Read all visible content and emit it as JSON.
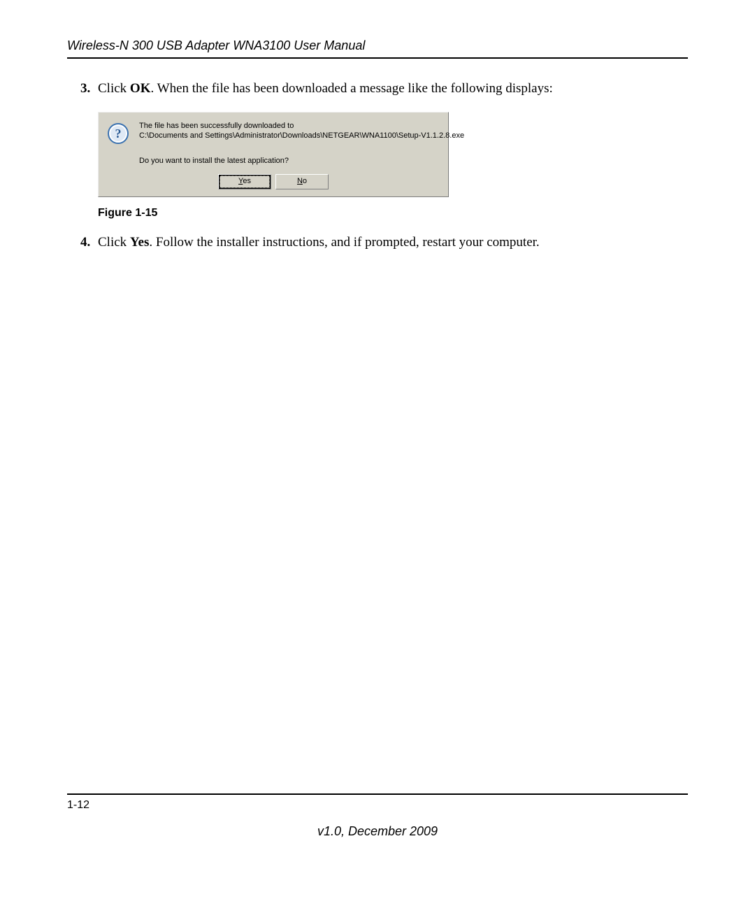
{
  "header": {
    "title": "Wireless-N 300 USB Adapter WNA3100 User Manual"
  },
  "steps": {
    "item3": {
      "number": "3.",
      "prefix": "Click ",
      "bold": "OK",
      "suffix": ". When the file has been downloaded a message like the following displays:"
    },
    "item4": {
      "number": "4.",
      "prefix": "Click ",
      "bold": "Yes",
      "suffix": ". Follow the installer instructions, and if prompted, restart your computer."
    }
  },
  "dialog": {
    "line1": "The file has been successfully downloaded to",
    "path": "C:\\Documents and Settings\\Administrator\\Downloads\\NETGEAR\\WNA1100\\Setup-V1.1.2.8.exe",
    "question": "Do you want to install the latest application?",
    "buttons": {
      "yes": "Yes",
      "no": "No"
    },
    "icon_name": "question-icon"
  },
  "figure_caption": "Figure 1-15",
  "footer": {
    "page": "1-12",
    "version": "v1.0, December 2009"
  }
}
